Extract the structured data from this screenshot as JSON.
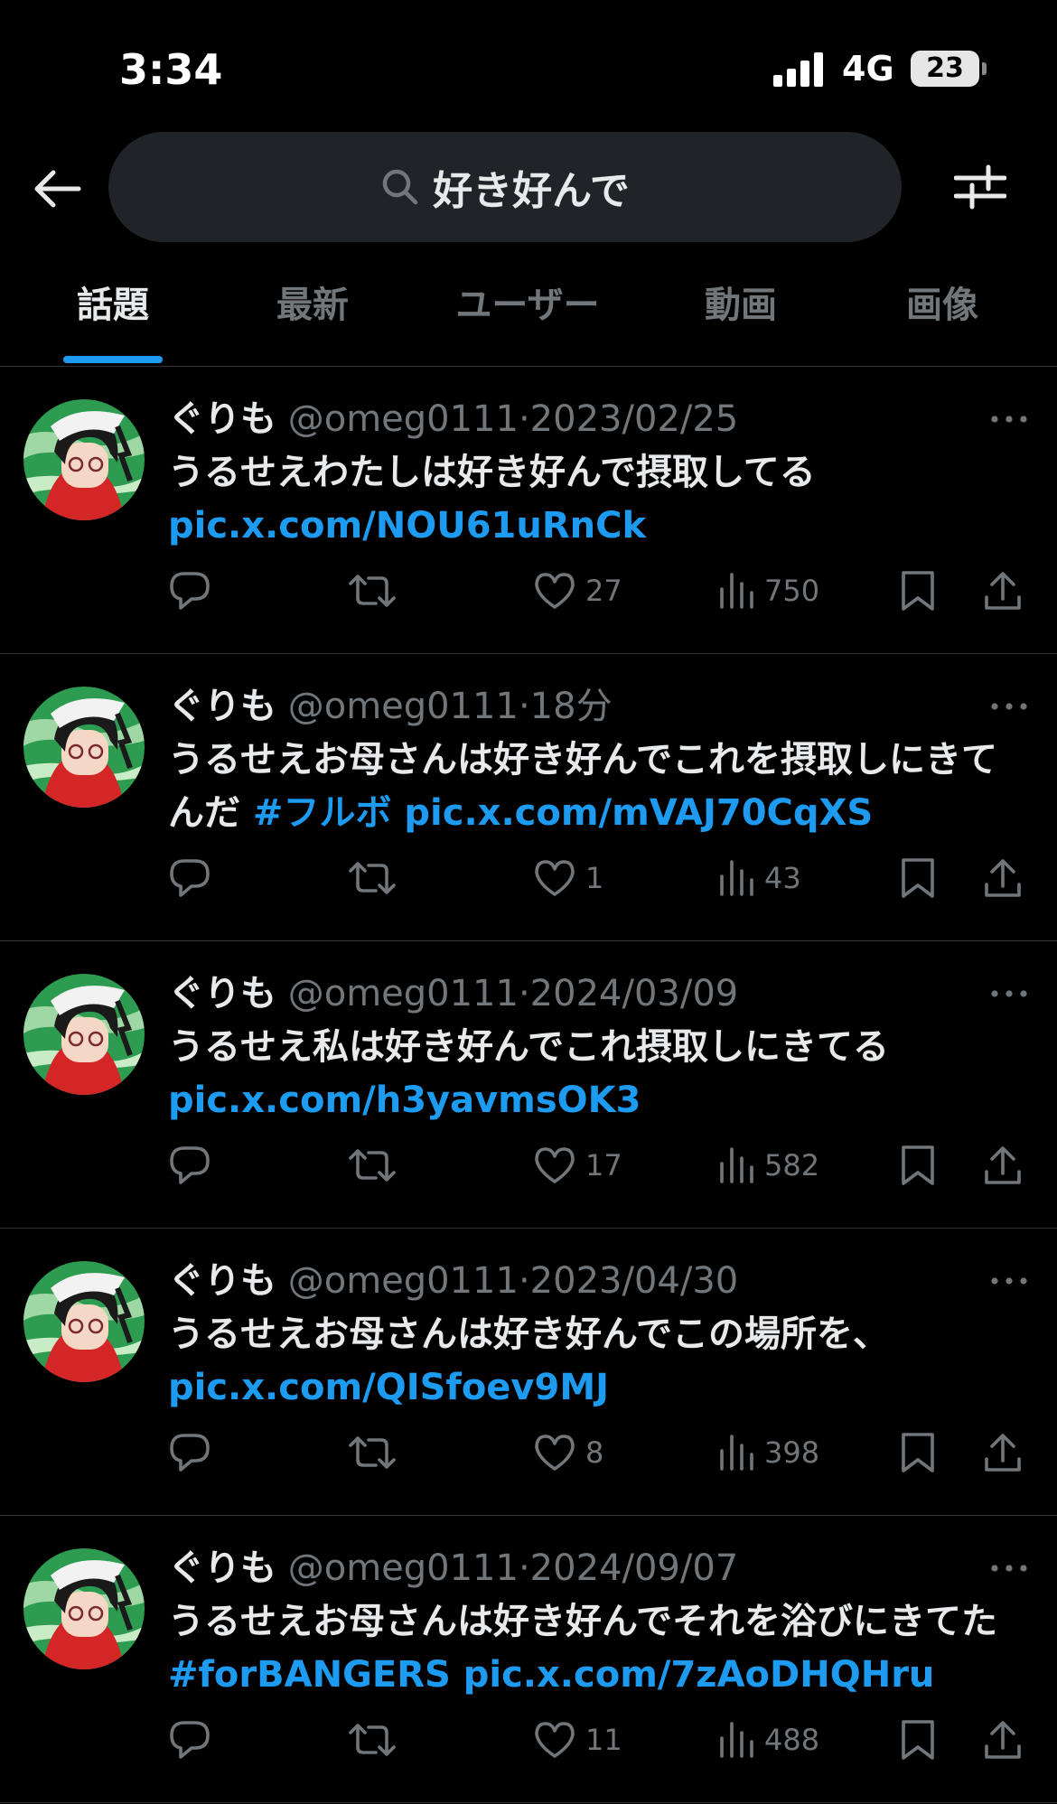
{
  "status": {
    "time": "3:34",
    "network": "4G",
    "battery": "23"
  },
  "search": {
    "query": "好き好んで"
  },
  "tabs": [
    {
      "label": "話題"
    },
    {
      "label": "最新"
    },
    {
      "label": "ユーザー"
    },
    {
      "label": "動画"
    },
    {
      "label": "画像"
    }
  ],
  "tweets": [
    {
      "name": "ぐりも",
      "handle": "@omeg0111",
      "date": "2023/02/25",
      "text": "うるせえわたしは好き好んで摂取してる",
      "tag": "",
      "link": "pic.x.com/NOU61uRnCk",
      "likes": "27",
      "views": "750"
    },
    {
      "name": "ぐりも",
      "handle": "@omeg0111",
      "date": "18分",
      "text": "うるせえお母さんは好き好んでこれを摂取しにきてんだ",
      "tag": "#フルボ",
      "link": "pic.x.com/mVAJ70CqXS",
      "likes": "1",
      "views": "43"
    },
    {
      "name": "ぐりも",
      "handle": "@omeg0111",
      "date": "2024/03/09",
      "text": "うるせえ私は好き好んでこれ摂取しにきてる",
      "tag": "",
      "link": "pic.x.com/h3yavmsOK3",
      "likes": "17",
      "views": "582"
    },
    {
      "name": "ぐりも",
      "handle": "@omeg0111",
      "date": "2023/04/30",
      "text": "うるせえお母さんは好き好んでこの場所を、",
      "tag": "",
      "link": "pic.x.com/QISfoev9MJ",
      "likes": "8",
      "views": "398"
    },
    {
      "name": "ぐりも",
      "handle": "@omeg0111",
      "date": "2024/09/07",
      "text": "うるせえお母さんは好き好んでそれを浴びにきてた",
      "tag": "#forBANGERS",
      "link": "pic.x.com/7zAoDHQHru",
      "likes": "11",
      "views": "488"
    }
  ],
  "colors": {
    "background": "#000000",
    "accent": "#1d9bf0",
    "muted": "#71767b",
    "text": "#e7e9ea"
  },
  "icons": [
    "back-arrow-icon",
    "search-icon",
    "filter-icon",
    "more-icon",
    "reply-icon",
    "retweet-icon",
    "like-icon",
    "views-icon",
    "bookmark-icon",
    "share-icon"
  ]
}
